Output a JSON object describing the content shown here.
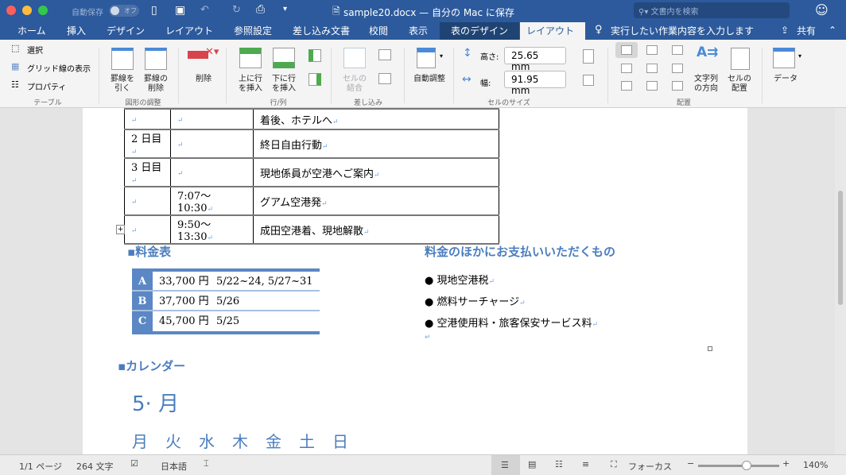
{
  "titlebar": {
    "autosave": "自動保存",
    "autosave_state": "オフ",
    "doc_title": "sample20.docx — 自分の Mac に保存",
    "search_placeholder": "文書内を検索"
  },
  "tabs": [
    "ホーム",
    "挿入",
    "デザイン",
    "レイアウト",
    "参照設定",
    "差し込み文書",
    "校閲",
    "表示",
    "表のデザイン",
    "レイアウト"
  ],
  "active_tab": 9,
  "tell_me": "実行したい作業内容を入力します",
  "share": "共有",
  "ribbon": {
    "table": {
      "select": "選択",
      "gridlines": "グリッド線の表示",
      "properties": "プロパティ",
      "label": "テーブル"
    },
    "draw": {
      "draw_table": "罫線を\n引く",
      "eraser": "罫線の\n削除",
      "label": "図形の調整"
    },
    "delete": "削除",
    "rows": {
      "insert_above": "上に行\nを挿入",
      "insert_below": "下に行\nを挿入",
      "label": "行/列"
    },
    "merge": {
      "merge_cells": "セルの\n結合",
      "label": "差し込み"
    },
    "autofit": "自動調整",
    "cellsize": {
      "height_label": "高さ:",
      "height_value": "25.65 mm",
      "width_label": "幅:",
      "width_value": "91.95 mm",
      "label": "セルのサイズ"
    },
    "align": {
      "text_direction": "文字列\nの方向",
      "cell_margins": "セルの\n配置",
      "label": "配置"
    },
    "data": "データ"
  },
  "schedule": [
    [
      "",
      "",
      "着後、ホテルへ"
    ],
    [
      "2 日目",
      "",
      "終日自由行動"
    ],
    [
      "3 日目",
      "",
      "現地係員が空港へご案内"
    ],
    [
      "",
      "7:07〜10:30",
      "グアム空港発"
    ],
    [
      "",
      "9:50〜13:30",
      "成田空港着、現地解散"
    ]
  ],
  "price": {
    "heading": "料金表",
    "rows": [
      [
        "A",
        "33,700 円",
        "5/22~24, 5/27~31"
      ],
      [
        "B",
        "37,700 円",
        "5/26"
      ],
      [
        "C",
        "45,700 円",
        "5/25"
      ]
    ]
  },
  "extra": {
    "heading": "料金のほかにお支払いいただくもの",
    "items": [
      "現地空港税",
      "燃料サーチャージ",
      "空港使用料・旅客保安サービス料"
    ]
  },
  "calendar": {
    "heading": "カレンダー",
    "month": "5· 月",
    "days": [
      "月",
      "火",
      "水",
      "木",
      "金",
      "土",
      "日"
    ]
  },
  "status": {
    "page": "1/1 ページ",
    "words": "264 文字",
    "language": "日本語",
    "focus": "フォーカス",
    "zoom": "140%",
    "zoom_level": 0.6
  }
}
